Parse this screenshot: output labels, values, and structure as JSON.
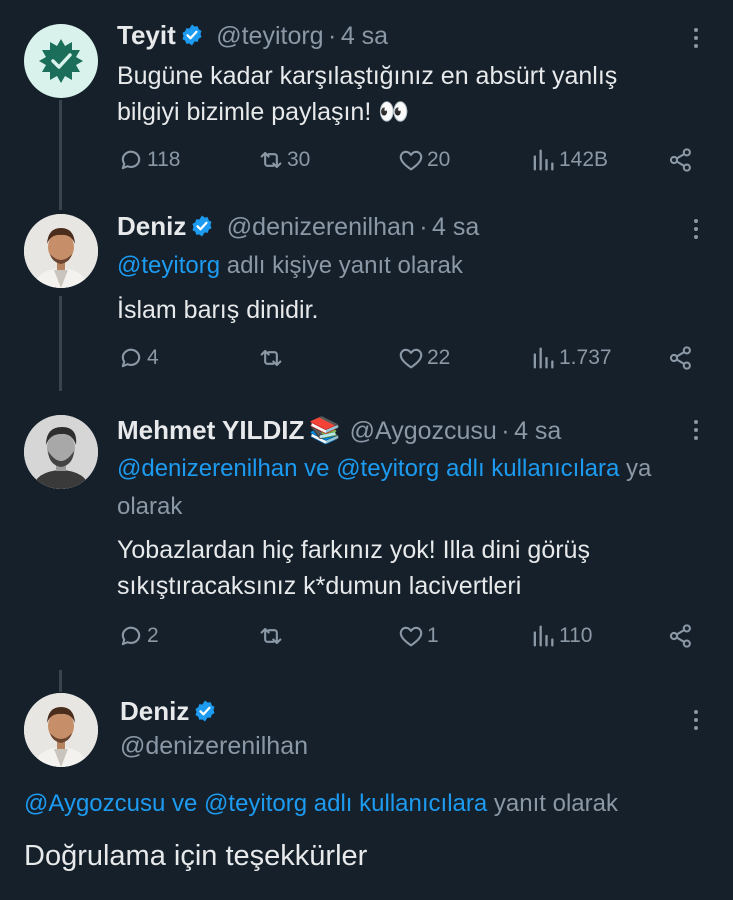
{
  "tweets": [
    {
      "name": "Teyit",
      "handle": "@teyitorg",
      "time": "4 sa",
      "text_line1": "Bugüne kadar karşılaştığınız en absürt yanlış",
      "text_line2": "bilgiyi bizimle paylaşın! 👀",
      "replies": "118",
      "retweets": "30",
      "likes": "20",
      "views": "142B"
    },
    {
      "name": "Deniz",
      "handle": "@denizerenilhan",
      "time": "4 sa",
      "reply_mention": "@teyitorg",
      "reply_suffix": "adlı kişiye yanıt olarak",
      "text_line1": "İslam barış dinidir.",
      "replies": "4",
      "retweets": "",
      "likes": "22",
      "views": "1.737"
    },
    {
      "name": "Mehmet YILDIZ",
      "name_emoji": "📚",
      "handle": "@Aygozcusu",
      "time": "4 sa",
      "reply_mention1": "@denizerenilhan",
      "reply_joiner": "ve",
      "reply_mention2": "@teyitorg",
      "reply_users": "adlı kullanıcılara",
      "reply_cut": "ya",
      "reply_line2": "olarak",
      "text_line1": "Yobazlardan hiç farkınız yok! Illa dini görüş",
      "text_line2": "sıkıştıracaksınız k*dumun lacivertleri",
      "replies": "2",
      "retweets": "",
      "likes": "1",
      "views": "110"
    },
    {
      "name": "Deniz",
      "handle": "@denizerenilhan",
      "reply_mention1": "@Aygozcusu",
      "reply_joiner": "ve",
      "reply_mention2": "@teyitorg",
      "reply_users": "adlı kullanıcılara",
      "reply_suffix": "yanıt olarak",
      "text_line1": "Doğrulama için teşekkürler"
    }
  ],
  "separator": "·",
  "colors": {
    "background": "#15202b",
    "text": "#e7e9ea",
    "secondary": "#8b98a5",
    "link": "#1d9bf0",
    "verified": "#1d9bf0",
    "teyit_avatar": "#d9f2ec",
    "teyit_badge": "#1b6e5a"
  },
  "icons": [
    "verified-badge-icon",
    "more-options-icon",
    "reply-icon",
    "retweet-icon",
    "like-icon",
    "views-icon",
    "share-icon"
  ]
}
